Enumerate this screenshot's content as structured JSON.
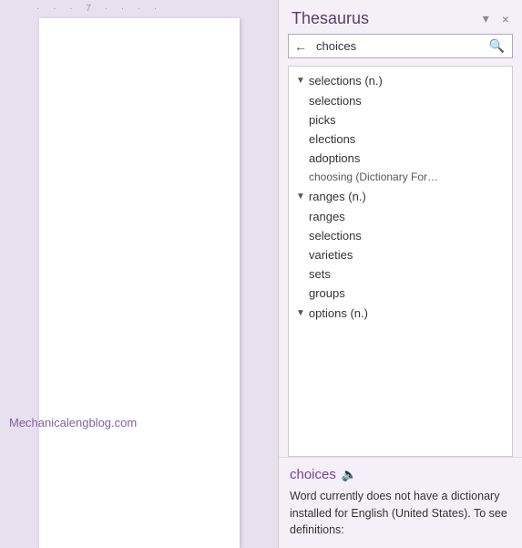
{
  "panel": {
    "title": "Thesaurus",
    "close_icon": "×",
    "pin_icon": "▾",
    "back_icon": "←"
  },
  "search": {
    "value": "choices",
    "placeholder": "choices",
    "search_icon": "🔍"
  },
  "results": {
    "sections": [
      {
        "id": "selections-n",
        "label": "selections (n.)",
        "items": [
          "selections",
          "picks",
          "elections",
          "adoptions",
          "choosing (Dictionary For…"
        ]
      },
      {
        "id": "ranges-n",
        "label": "ranges (n.)",
        "items": [
          "ranges",
          "selections",
          "varieties",
          "sets",
          "groups"
        ]
      },
      {
        "id": "options-n",
        "label": "options (n.)",
        "items": []
      }
    ]
  },
  "definition": {
    "word": "choices",
    "speaker_icon": "🔊",
    "text": "Word currently does not have a dictionary installed for English (United States). To see definitions:"
  },
  "watermark": {
    "text": "Mechanicalengblog.com"
  },
  "ruler": {
    "marks": "· · · 7 · · · ·"
  }
}
